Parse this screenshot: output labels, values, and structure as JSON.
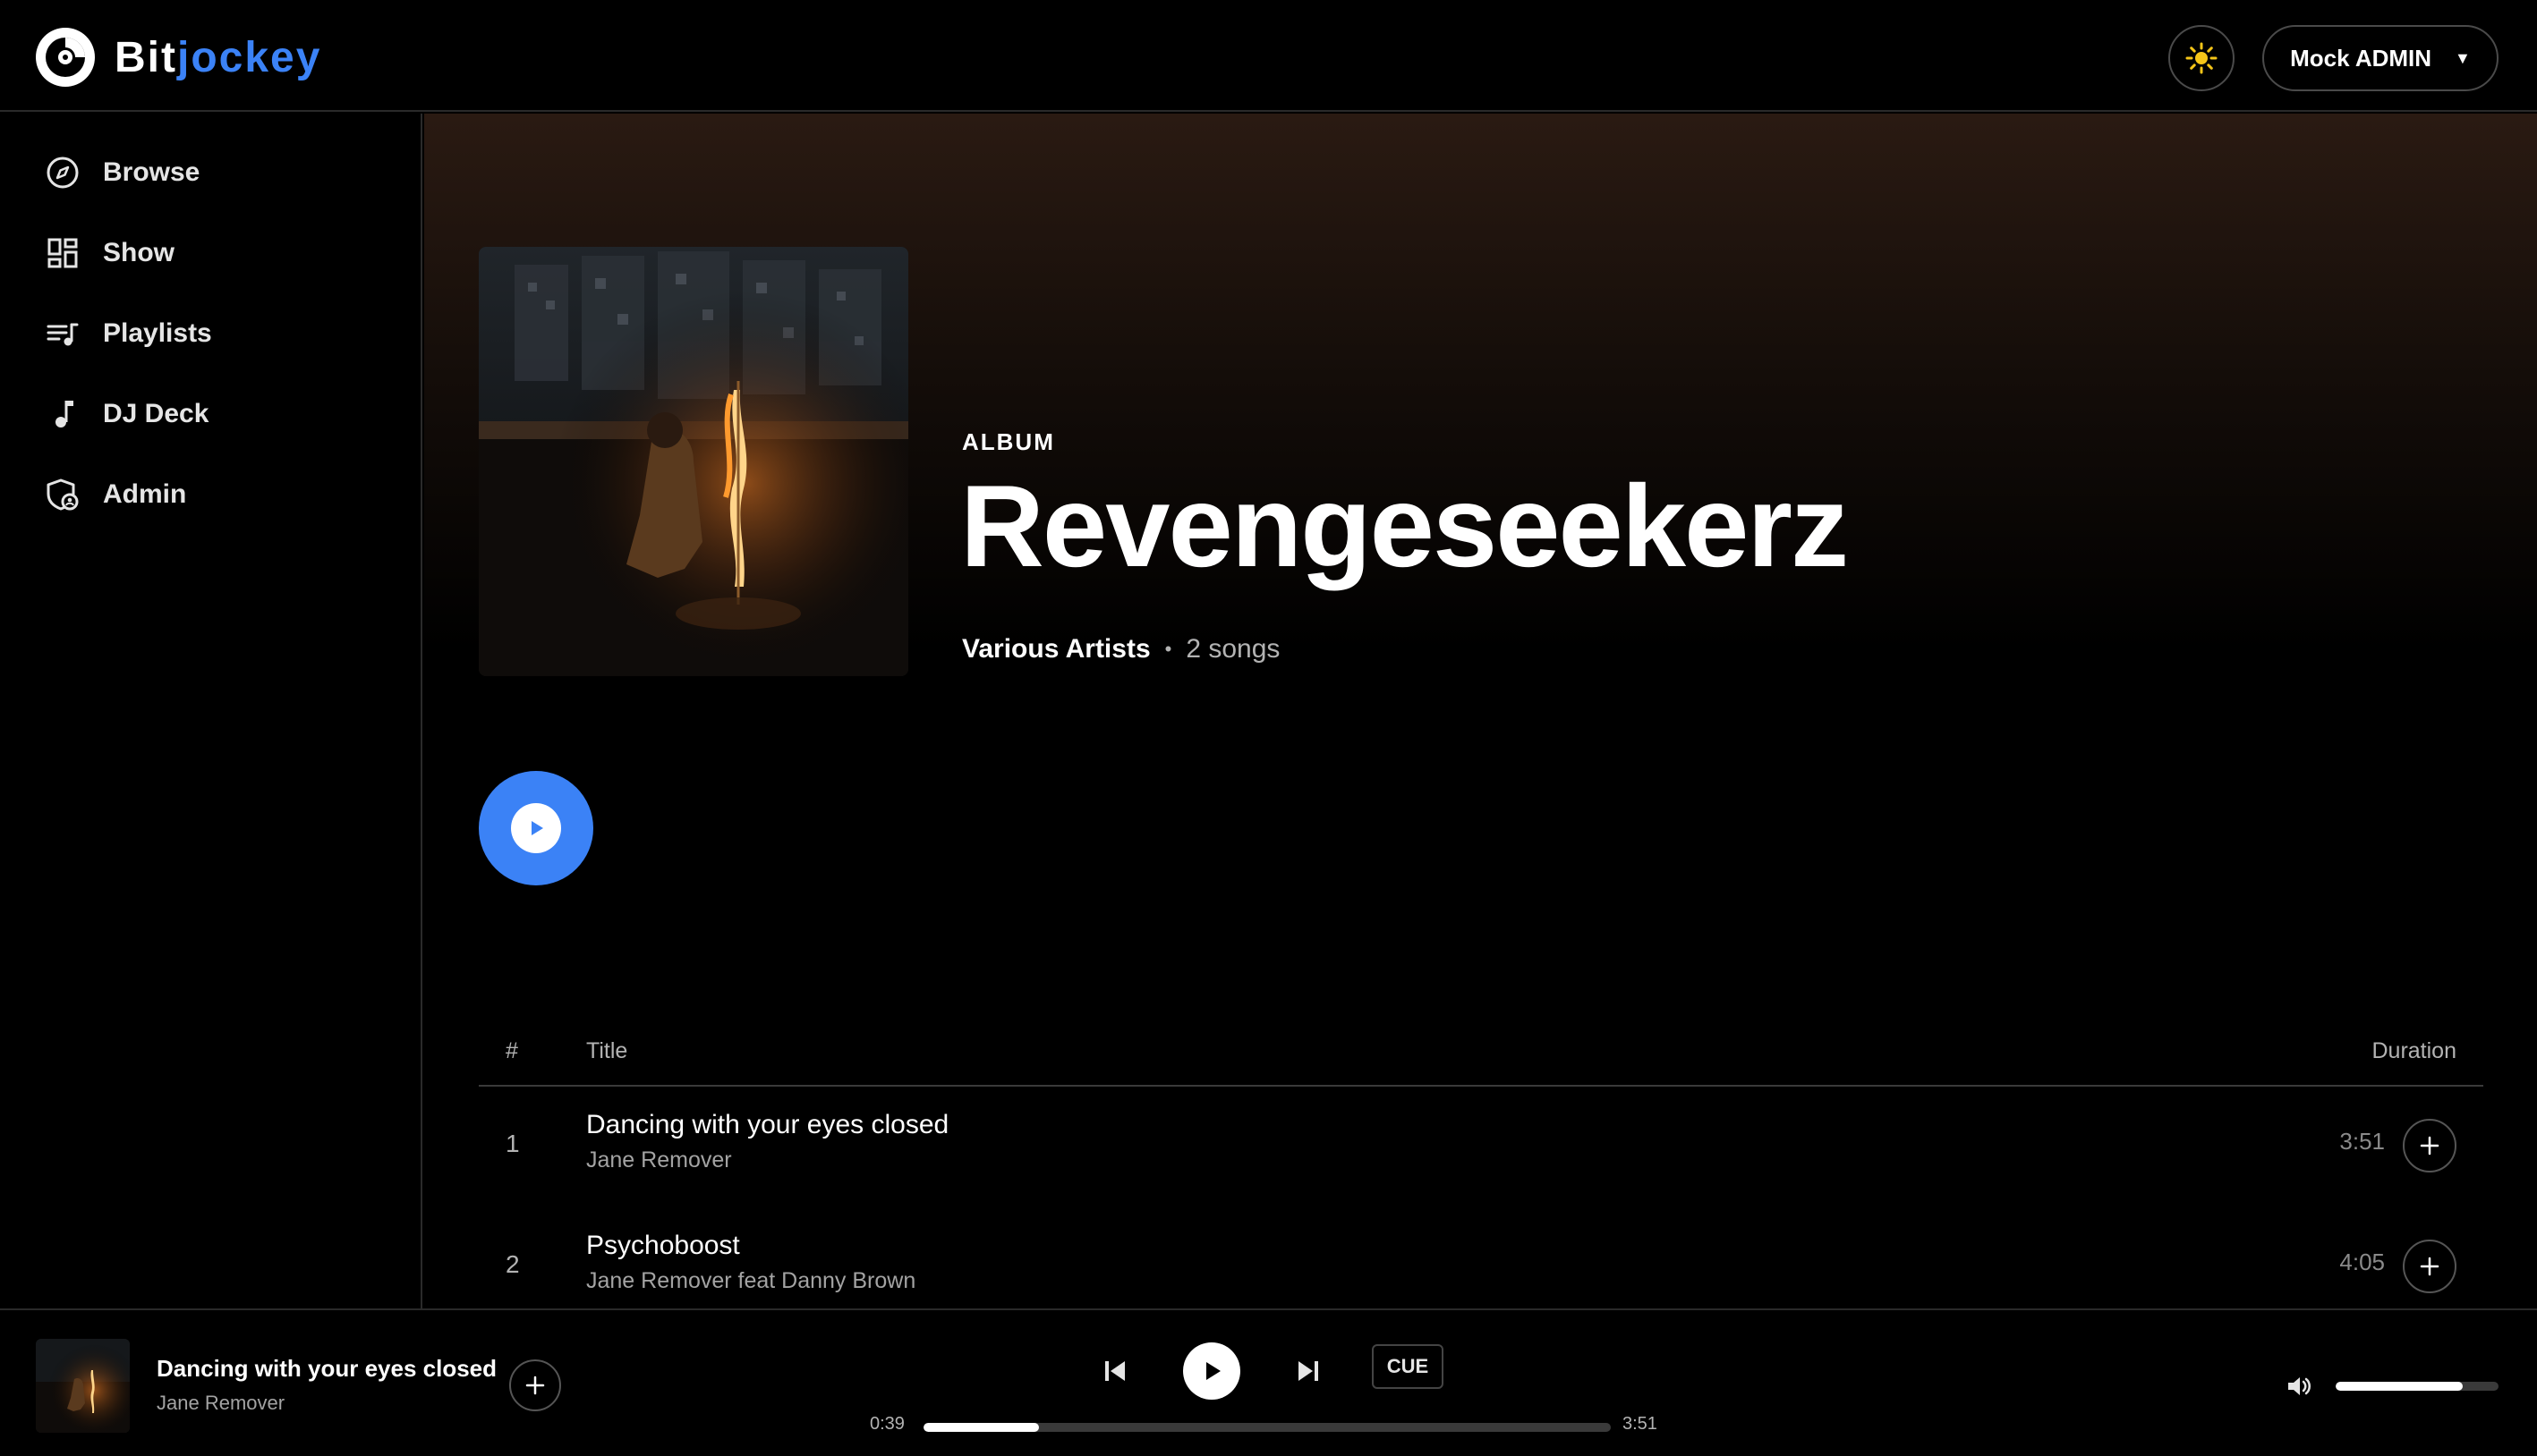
{
  "app": {
    "name_part1": "Bit",
    "name_part2": "jockey"
  },
  "header": {
    "user_label": "Mock ADMIN",
    "caret": "▼"
  },
  "sidebar": {
    "items": [
      {
        "label": "Browse",
        "icon": "compass-icon"
      },
      {
        "label": "Show",
        "icon": "grid-icon"
      },
      {
        "label": "Playlists",
        "icon": "playlist-icon"
      },
      {
        "label": "DJ Deck",
        "icon": "music-note-icon"
      },
      {
        "label": "Admin",
        "icon": "admin-shield-icon"
      }
    ]
  },
  "album": {
    "kind": "ALBUM",
    "title": "Revengeseekerz",
    "artist": "Various Artists",
    "separator": "•",
    "song_count": "2 songs"
  },
  "table": {
    "headers": {
      "number": "#",
      "title": "Title",
      "duration": "Duration"
    },
    "rows": [
      {
        "number": "1",
        "title": "Dancing with your eyes closed",
        "artist": "Jane Remover",
        "duration": "3:51"
      },
      {
        "number": "2",
        "title": "Psychoboost",
        "artist": "Jane Remover feat Danny Brown",
        "duration": "4:05"
      }
    ]
  },
  "player": {
    "title": "Dancing with your eyes closed",
    "artist": "Jane Remover",
    "cue_label": "CUE",
    "current_time": "0:39",
    "total_time": "3:51",
    "progress": 0.168,
    "volume": 0.78
  },
  "colors": {
    "accent": "#3b82f6",
    "sun": "#f5c518"
  }
}
